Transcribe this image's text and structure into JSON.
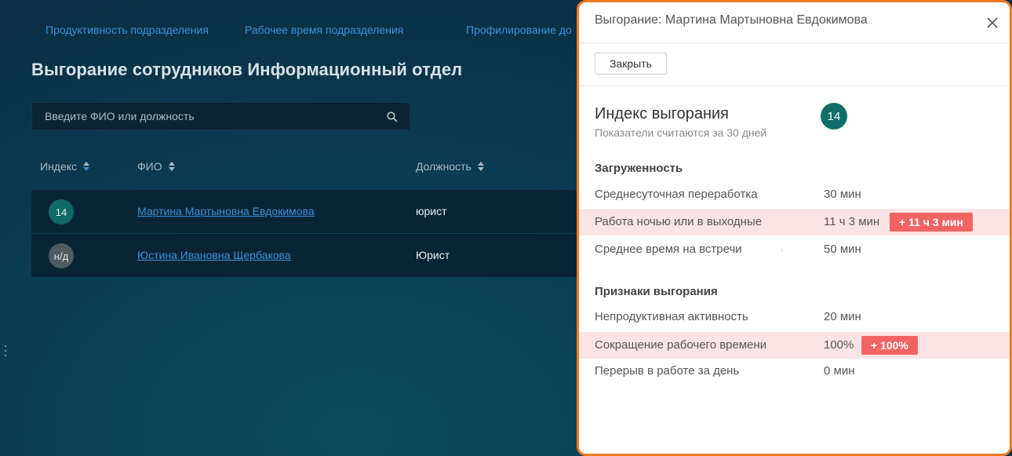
{
  "nav": {
    "items": [
      "Продуктивность подразделения",
      "Рабочее время подразделения",
      "Профилирование до"
    ]
  },
  "page": {
    "title": "Выгорание сотрудников Информационный отдел"
  },
  "search": {
    "placeholder": "Введите ФИО или должность"
  },
  "table": {
    "headers": [
      "Индекс",
      "ФИО",
      "Должность"
    ],
    "rows": [
      {
        "index": "14",
        "name": "Мартина Мартыновна Евдокимова",
        "position": "юрист"
      },
      {
        "index": "н/д",
        "name": "Юстина Ивановна Щербакова",
        "position": "Юрист"
      }
    ]
  },
  "panel": {
    "title": "Выгорание: Мартина Мартыновна Евдокимова",
    "close_button": "Закрыть",
    "index_title": "Индекс выгорания",
    "index_subtitle": "Показатели считаются за 30 дней",
    "index_value": "14",
    "sections": [
      {
        "title": "Загруженность",
        "rows": [
          {
            "label": "Среднесуточная переработка",
            "value": "30 мин"
          },
          {
            "label": "Работа ночью или в выходные",
            "value": "11 ч 3 мин",
            "delta": "+ 11 ч 3 мин"
          },
          {
            "label": "Среднее время на встречи",
            "value": "50 мин"
          }
        ]
      },
      {
        "title": "Признаки выгорания",
        "rows": [
          {
            "label": "Непродуктивная активность",
            "value": "20 мин"
          },
          {
            "label": "Сокращение рабочего времени",
            "value": "100%",
            "delta": "+ 100%"
          },
          {
            "label": "Перерыв в работе за день",
            "value": "0 мин"
          }
        ]
      }
    ]
  },
  "colors": {
    "accent_link": "#3d8fd8",
    "panel_border": "#f07a1c",
    "index_badge": "#0f6e6a",
    "alert": "#f26464",
    "alert_bg": "#fde4e4"
  }
}
